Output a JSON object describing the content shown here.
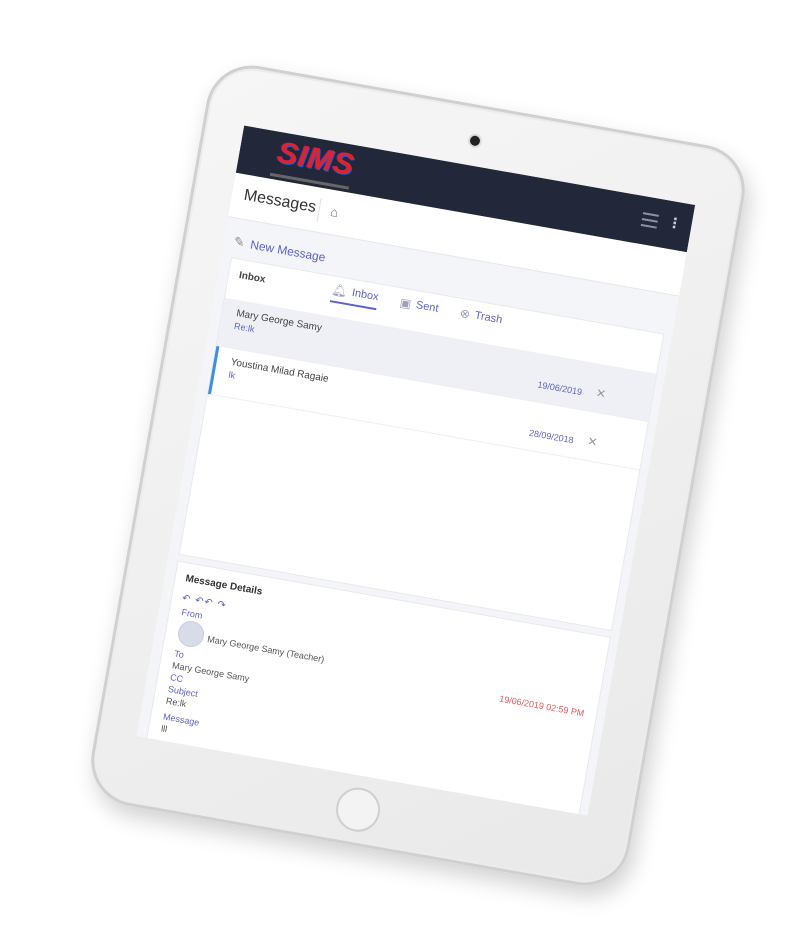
{
  "app": {
    "logo_text": "SIMS"
  },
  "header": {
    "page_title": "Messages"
  },
  "actions": {
    "new_message": "New Message"
  },
  "tabs": [
    {
      "label": "Inbox",
      "icon": "bell-icon",
      "active": true
    },
    {
      "label": "Sent",
      "icon": "sent-icon",
      "active": false
    },
    {
      "label": "Trash",
      "icon": "trash-icon",
      "active": false
    }
  ],
  "inbox": {
    "heading": "Inbox",
    "messages": [
      {
        "sender": "Mary George Samy",
        "snippet": "Re:lk",
        "date": "19/06/2019",
        "selected": true
      },
      {
        "sender": "Youstina Milad Ragaie",
        "snippet": "lk",
        "date": "28/09/2018",
        "unread": true
      }
    ]
  },
  "details": {
    "heading": "Message Details",
    "from_label": "From",
    "from_value": "Mary George Samy (Teacher)",
    "date": "19/06/2019 02:59 PM",
    "to_label": "To",
    "to_value": "Mary George Samy",
    "cc_label": "CC",
    "subject_label": "Subject",
    "subject_value": "Re:lk",
    "message_label": "Message",
    "message_value": "lll"
  },
  "colors": {
    "accent": "#5d63c8",
    "topbar": "#22273a",
    "unread_marker": "#3c8ee0",
    "date_red": "#e05a5a"
  }
}
